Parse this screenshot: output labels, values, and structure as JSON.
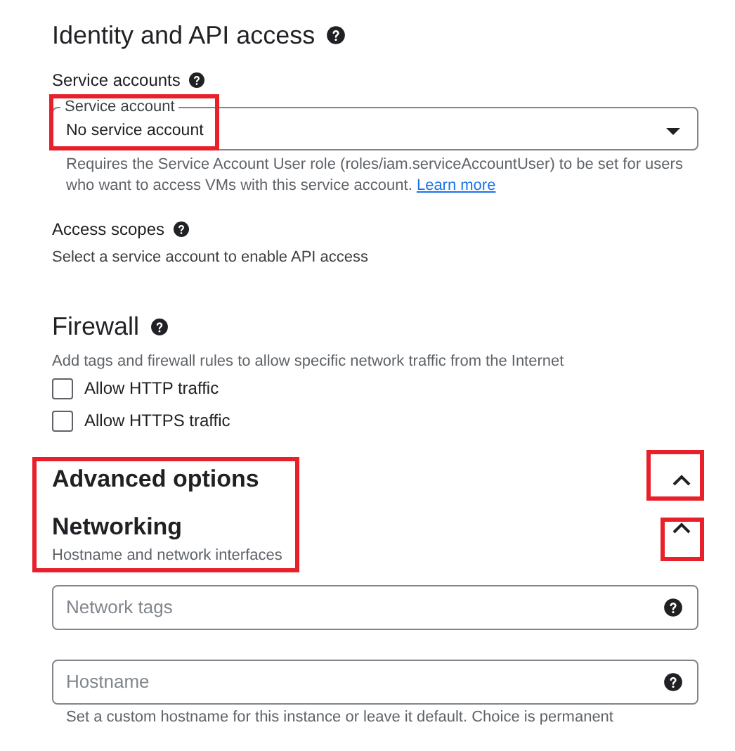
{
  "identity": {
    "title": "Identity and API access",
    "service_accounts": {
      "label": "Service accounts",
      "field_label": "Service account",
      "value": "No service account",
      "help": "Requires the Service Account User role (roles/iam.serviceAccountUser) to be set for users who want to access VMs with this service account.",
      "link": "Learn more"
    },
    "access_scopes": {
      "label": "Access scopes",
      "text": "Select a service account to enable API access"
    }
  },
  "firewall": {
    "title": "Firewall",
    "text": "Add tags and firewall rules to allow specific network traffic from the Internet",
    "options": [
      {
        "label": "Allow HTTP traffic",
        "checked": false
      },
      {
        "label": "Allow HTTPS traffic",
        "checked": false
      }
    ]
  },
  "advanced": {
    "title": "Advanced options",
    "expanded": true
  },
  "networking": {
    "title": "Networking",
    "subtitle": "Hostname and network interfaces",
    "expanded": true,
    "fields": [
      {
        "placeholder": "Network tags"
      },
      {
        "placeholder": "Hostname",
        "help": "Set a custom hostname for this instance or leave it default. Choice is permanent"
      }
    ]
  }
}
